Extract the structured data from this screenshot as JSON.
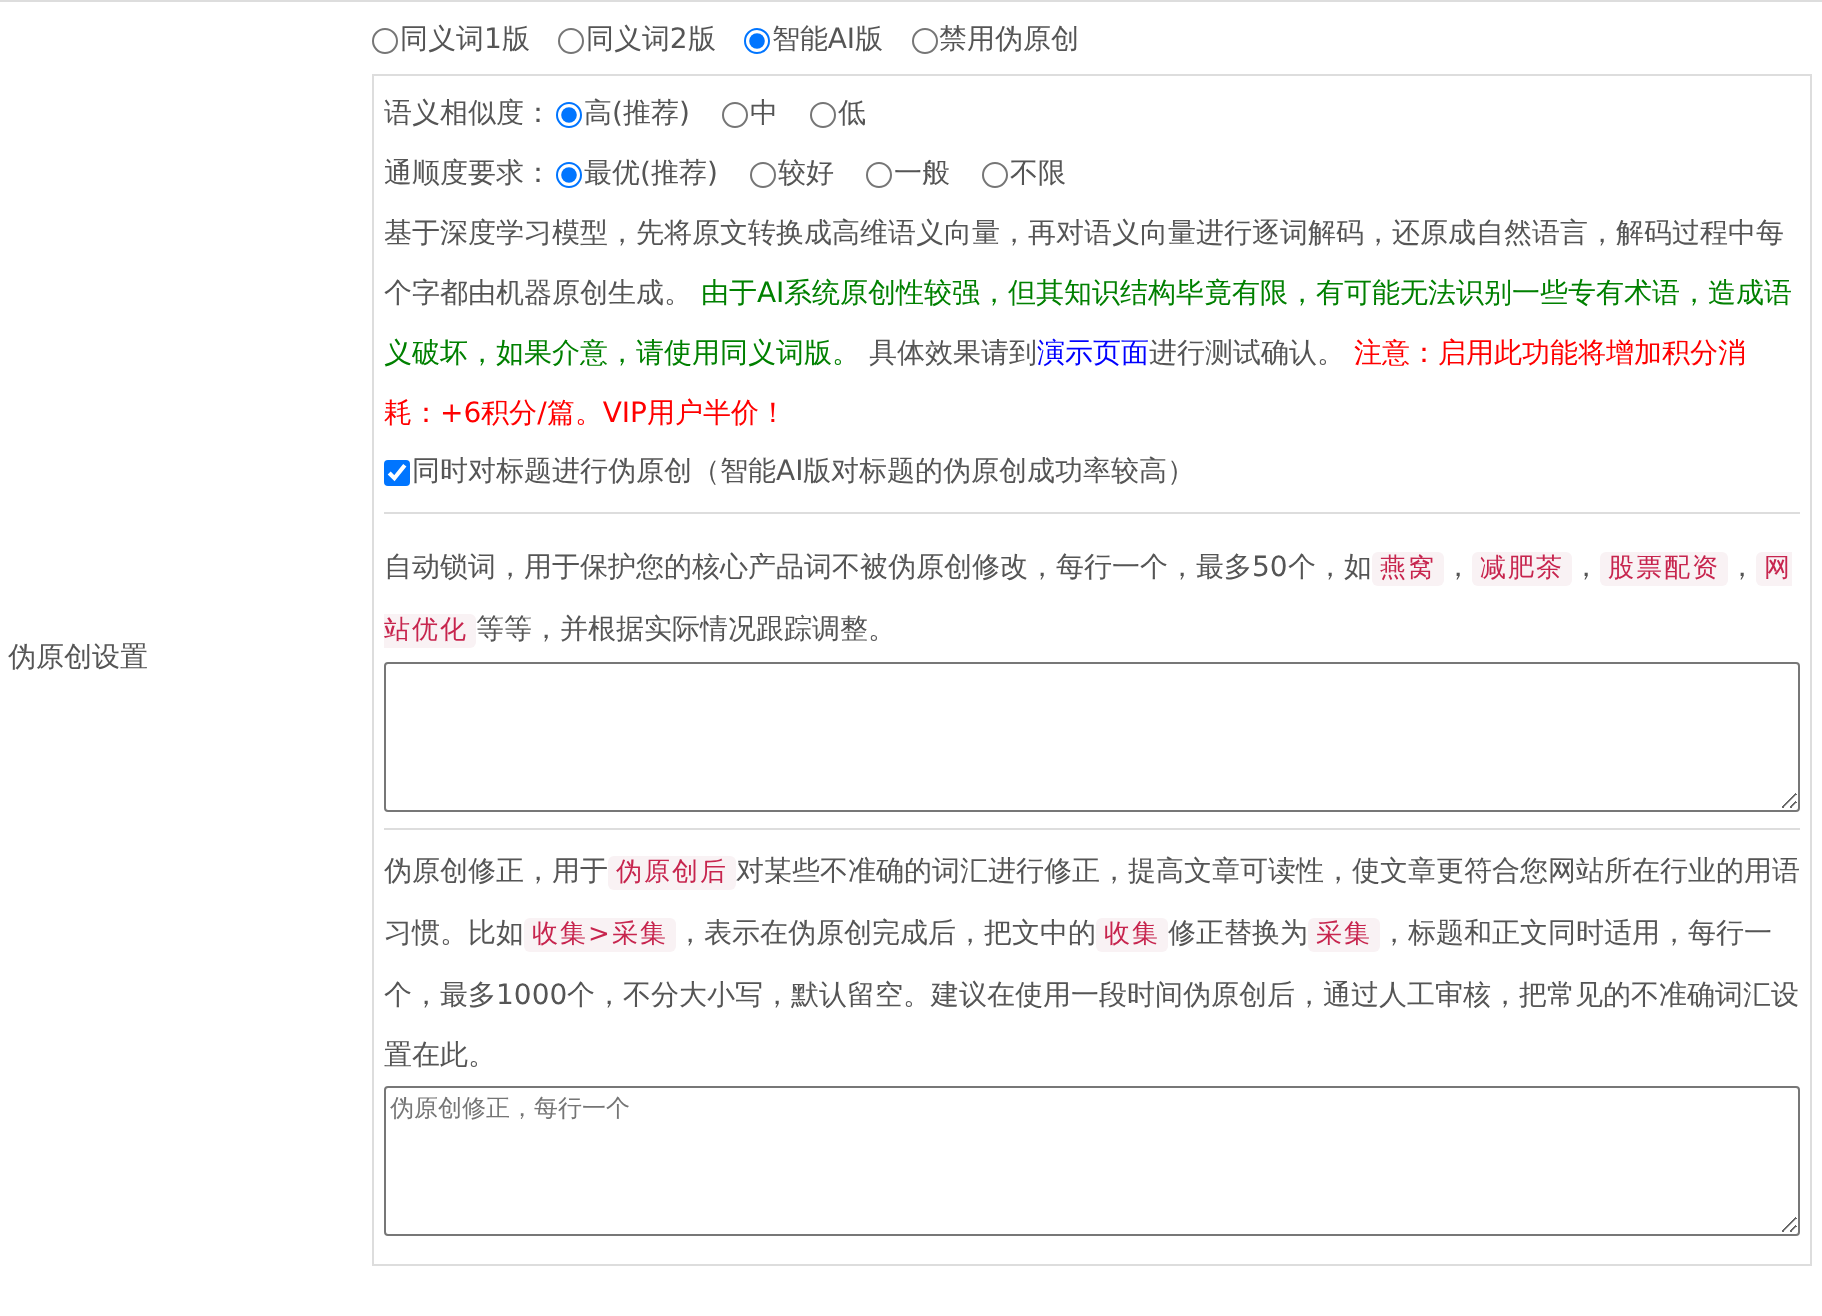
{
  "section_label": "伪原创设置",
  "mode_options": [
    {
      "label": "同义词1版",
      "selected": false
    },
    {
      "label": "同义词2版",
      "selected": false
    },
    {
      "label": "智能AI版",
      "selected": true
    },
    {
      "label": "禁用伪原创",
      "selected": false
    }
  ],
  "similarity": {
    "label": "语义相似度：",
    "options": [
      {
        "label": "高(推荐)",
        "selected": true
      },
      {
        "label": "中",
        "selected": false
      },
      {
        "label": "低",
        "selected": false
      }
    ]
  },
  "fluency": {
    "label": "通顺度要求：",
    "options": [
      {
        "label": "最优(推荐)",
        "selected": true
      },
      {
        "label": "较好",
        "selected": false
      },
      {
        "label": "一般",
        "selected": false
      },
      {
        "label": "不限",
        "selected": false
      }
    ]
  },
  "ai_description": [
    {
      "kind": "plain",
      "text": "基于深度学习模型，先将原文转换成高维语义向量，再对语义向量进行逐词解码，还原成自然语言，解码过程中每个字都由机器原创生成。 "
    },
    {
      "kind": "green",
      "text": "由于AI系统原创性较强，但其知识结构毕竟有限，有可能无法识别一些专有术语，造成语义破坏，如果介意，请使用同义词版。"
    },
    {
      "kind": "plain",
      "text": " 具体效果请到"
    },
    {
      "kind": "link",
      "text": "演示页面"
    },
    {
      "kind": "plain",
      "text": "进行测试确认。 "
    },
    {
      "kind": "red",
      "text": "注意：启用此功能将增加积分消耗：+6积分/篇。VIP用户半价！"
    }
  ],
  "title_option": {
    "label": "同时对标题进行伪原创（智能AI版对标题的伪原创成功率较高）",
    "checked": true
  },
  "lock_words": {
    "description": [
      {
        "kind": "plain",
        "text": "自动锁词，用于保护您的核心产品词不被伪原创修改，每行一个，最多50个，如"
      },
      {
        "kind": "code",
        "text": "燕窝"
      },
      {
        "kind": "plain",
        "text": "，"
      },
      {
        "kind": "code",
        "text": "减肥茶"
      },
      {
        "kind": "plain",
        "text": "，"
      },
      {
        "kind": "code",
        "text": "股票配资"
      },
      {
        "kind": "plain",
        "text": "，"
      },
      {
        "kind": "code",
        "text": "网站优化"
      },
      {
        "kind": "plain",
        "text": "等等，并根据实际情况跟踪调整。"
      }
    ]
  },
  "correction": {
    "description": [
      {
        "kind": "plain",
        "text": "伪原创修正，用于"
      },
      {
        "kind": "code",
        "text": "伪原创后"
      },
      {
        "kind": "plain",
        "text": "对某些不准确的词汇进行修正，提高文章可读性，使文章更符合您网站所在行业的用语习惯。比如"
      },
      {
        "kind": "code",
        "text": "收集>采集"
      },
      {
        "kind": "plain",
        "text": "，表示在伪原创完成后，把文中的"
      },
      {
        "kind": "code",
        "text": "收集"
      },
      {
        "kind": "plain",
        "text": "修正替换为"
      },
      {
        "kind": "code",
        "text": "采集"
      },
      {
        "kind": "plain",
        "text": "，标题和正文同时适用，每行一个，最多1000个，不分大小写，默认留空。建议在使用一段时间伪原创后，通过人工审核，把常见的不准确词汇设置在此。"
      }
    ],
    "placeholder": "伪原创修正，每行一个"
  }
}
